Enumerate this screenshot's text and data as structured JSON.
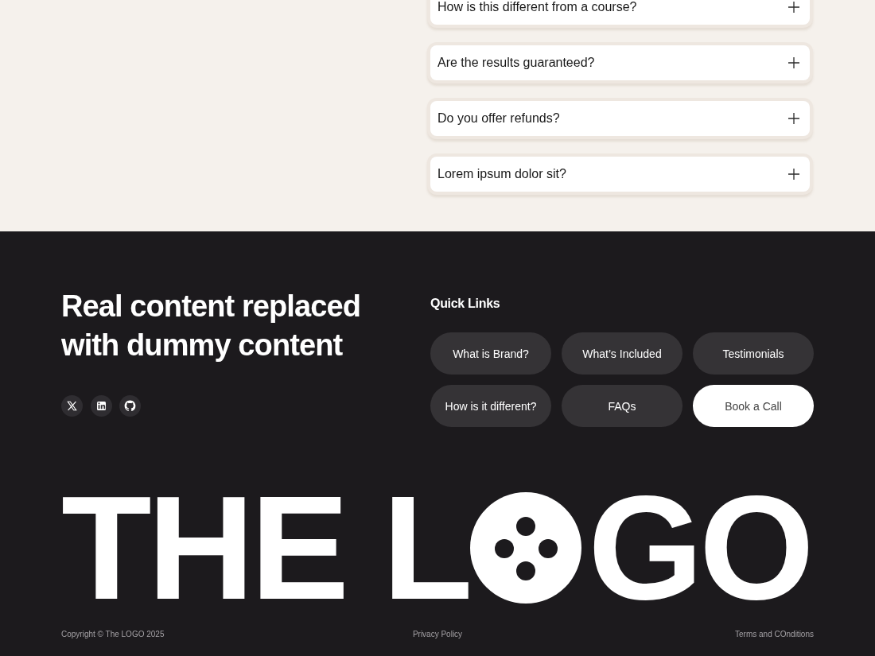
{
  "faq": {
    "items": [
      {
        "question": "How is this different from a course?",
        "expanded": false
      },
      {
        "question": "Are the results guaranteed?",
        "expanded": false
      },
      {
        "question": "Do you offer refunds?",
        "expanded": false
      },
      {
        "question": "Lorem ipsum dolor sit?",
        "expanded": false
      }
    ]
  },
  "footer": {
    "heading": "Real content replaced with dummy content",
    "social_links": [
      {
        "kind": "x"
      },
      {
        "kind": "linkedin"
      },
      {
        "kind": "github"
      }
    ],
    "quick_links": {
      "title": "Quick Links",
      "links": [
        {
          "label": "What is Brand?",
          "kind": "pill"
        },
        {
          "label": "What’s Included",
          "kind": "pill"
        },
        {
          "label": "Testimonials",
          "kind": "pill"
        },
        {
          "label": "How is it different?",
          "kind": "pill"
        },
        {
          "label": "FAQs",
          "kind": "pill"
        },
        {
          "label": "Book a Call",
          "kind": "cta"
        }
      ]
    },
    "logo": {
      "lead": "THE L",
      "tail": "GO"
    },
    "bottom_bar": {
      "copyright": "Copyright © The LOGO 2025",
      "links": [
        "Privacy Policy",
        "Terms and COnditions"
      ]
    }
  }
}
